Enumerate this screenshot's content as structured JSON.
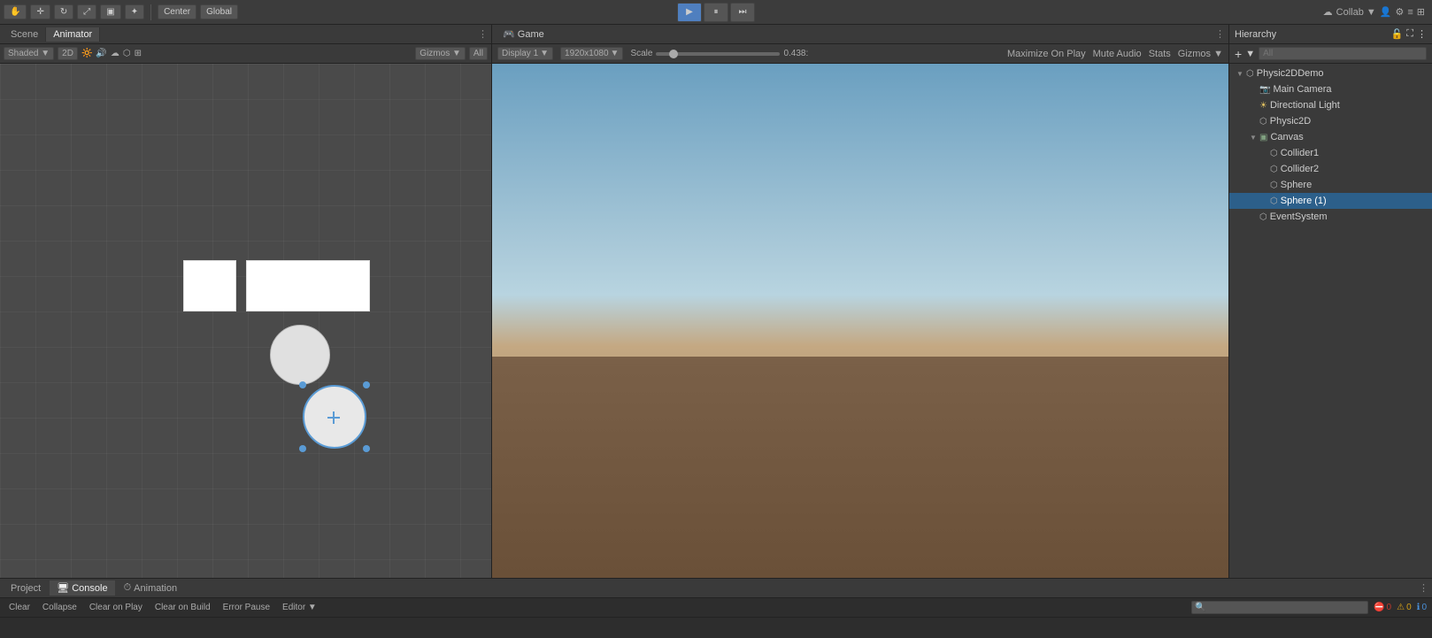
{
  "toolbar": {
    "scene_label": "Scene",
    "animator_label": "Animator",
    "transform_mode": "Center",
    "space_mode": "Global",
    "play_btn": "▶",
    "pause_btn": "⏸",
    "step_btn": "⏭",
    "collab_label": "Collab ▼",
    "gizmos_label": "Gizmos ▼",
    "all_label": "All"
  },
  "scene_panel": {
    "tab1": "Scene",
    "tab2": "Animator",
    "mode_2d": "2D",
    "toolbar_items": [
      "Shaded",
      "2D",
      "🔆",
      "🔊",
      "☁",
      "⚡",
      "▣",
      "≡",
      "🎯",
      "⊙",
      "Gizmos ▼",
      "All ▼"
    ]
  },
  "game_panel": {
    "tab_label": "Game",
    "display": "Display 1",
    "resolution": "1920x1080",
    "scale_label": "Scale",
    "scale_value": "0.438:",
    "maximize_on_play": "Maximize On Play",
    "mute_audio": "Mute Audio",
    "stats": "Stats",
    "gizmos": "Gizmos ▼"
  },
  "hierarchy": {
    "title": "Hierarchy",
    "search_placeholder": "All",
    "items": [
      {
        "id": "physic2ddemo",
        "label": "Physic2DDemo",
        "indent": 0,
        "icon": "▸",
        "expanded": true
      },
      {
        "id": "main-camera",
        "label": "Main Camera",
        "indent": 1,
        "icon": "📷"
      },
      {
        "id": "directional-light",
        "label": "Directional Light",
        "indent": 1,
        "icon": "☀"
      },
      {
        "id": "physic2d",
        "label": "Physic2D",
        "indent": 1,
        "icon": "⬡"
      },
      {
        "id": "canvas",
        "label": "Canvas",
        "indent": 1,
        "icon": "▸",
        "expanded": true
      },
      {
        "id": "collider1",
        "label": "Collider1",
        "indent": 2,
        "icon": "⬡"
      },
      {
        "id": "collider2",
        "label": "Collider2",
        "indent": 2,
        "icon": "⬡"
      },
      {
        "id": "sphere",
        "label": "Sphere",
        "indent": 2,
        "icon": "⬡"
      },
      {
        "id": "sphere1",
        "label": "Sphere (1)",
        "indent": 2,
        "icon": "⬡",
        "selected": true
      },
      {
        "id": "eventsystem",
        "label": "EventSystem",
        "indent": 1,
        "icon": "⬡"
      }
    ]
  },
  "bottom": {
    "tabs": [
      "Project",
      "Console",
      "Animation"
    ],
    "active_tab": "Console",
    "toolbar_btns": [
      "Clear",
      "Collapse",
      "Clear on Play",
      "Clear on Build",
      "Error Pause",
      "Editor ▼"
    ],
    "search_placeholder": "",
    "errors": "0",
    "warnings": "0",
    "infos": "0"
  }
}
